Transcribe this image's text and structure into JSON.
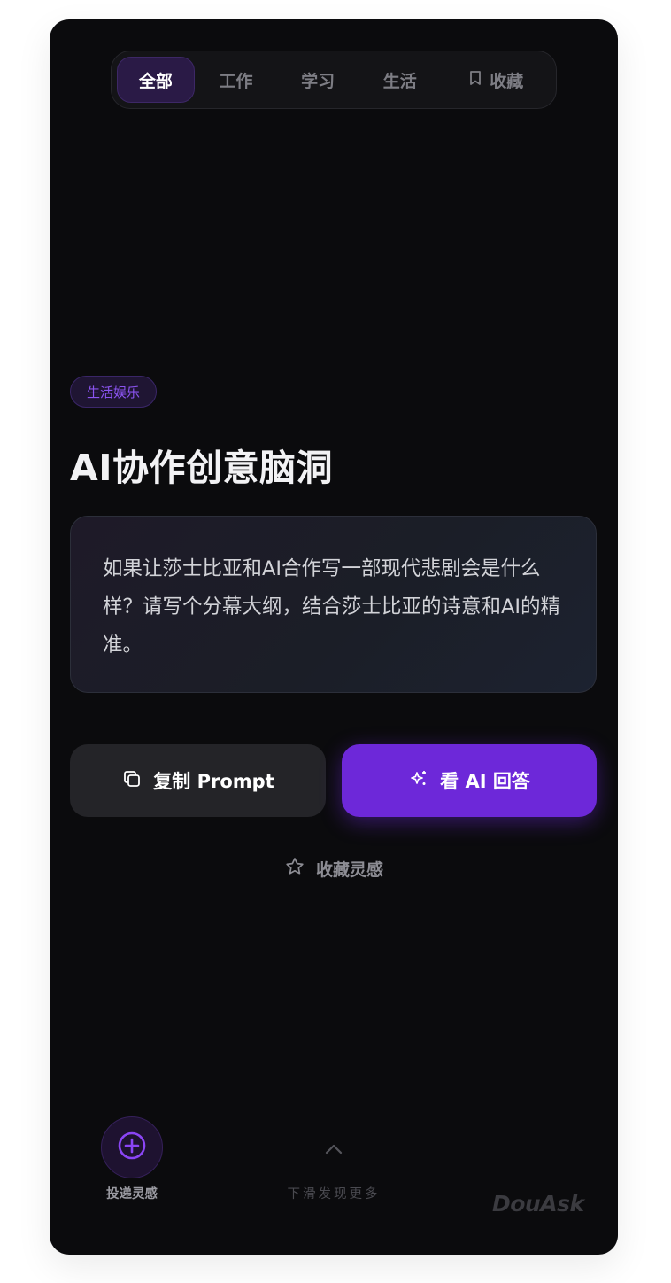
{
  "tabs": [
    {
      "label": "全部",
      "active": true
    },
    {
      "label": "工作",
      "active": false
    },
    {
      "label": "学习",
      "active": false
    },
    {
      "label": "生活",
      "active": false
    },
    {
      "label": "收藏",
      "active": false,
      "icon": "bookmark-icon"
    }
  ],
  "card": {
    "category": "生活娱乐",
    "title": "AI协作创意脑洞",
    "prompt": "如果让莎士比亚和AI合作写一部现代悲剧会是什么样？请写个分幕大纲，结合莎士比亚的诗意和AI的精准。"
  },
  "actions": {
    "copy_label": "复制 Prompt",
    "copy_icon": "copy-icon",
    "ai_label": "看 AI 回答",
    "ai_icon": "sparkles-icon",
    "favorite_label": "收藏灵感",
    "favorite_icon": "star-icon"
  },
  "footer": {
    "submit_label": "投递灵感",
    "submit_icon": "plus-circle-icon",
    "swipe_label": "下滑发现更多",
    "swipe_icon": "chevron-up-icon",
    "logo": "DouAsk"
  },
  "colors": {
    "accent": "#6d28d9",
    "background": "#0b0b0d",
    "badge_text": "#8b54f0"
  }
}
